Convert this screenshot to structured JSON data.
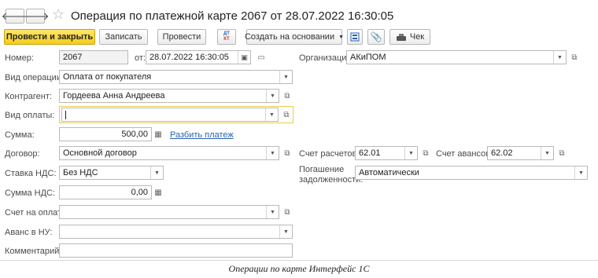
{
  "window": {
    "title": "Операция по платежной карте 2067 от 28.07.2022 16:30:05",
    "back_glyph": "🡐",
    "forward_glyph": "🡒",
    "star_glyph": "☆"
  },
  "toolbar": {
    "post_and_close": "Провести и закрыть",
    "save": "Записать",
    "post": "Провести",
    "dt_kt_top": "ДТ",
    "dt_kt_bottom": "КТ",
    "create_based_on": "Создать на основании",
    "check": "Чек"
  },
  "form": {
    "number_label": "Номер:",
    "number_value": "2067",
    "date_label": "от:",
    "date_value": "28.07.2022 16:30:05",
    "organization_label": "Организация:",
    "organization_value": "АКиПОМ",
    "operation_type_label": "Вид операции:",
    "operation_type_value": "Оплата от покупателя",
    "counterparty_label": "Контрагент:",
    "counterparty_value": "Гордеева Анна Андреева",
    "payment_type_label": "Вид оплаты:",
    "payment_type_value": "",
    "amount_label": "Сумма:",
    "amount_value": "500,00",
    "split_payment_link": "Разбить платеж",
    "contract_label": "Договор:",
    "contract_value": "Основной договор",
    "settlement_account_label": "Счет расчетов:",
    "settlement_account_value": "62.01",
    "advance_account_label": "Счет авансов:",
    "advance_account_value": "62.02",
    "vat_rate_label": "Ставка НДС:",
    "vat_rate_value": "Без НДС",
    "debt_repayment_label_1": "Погашение",
    "debt_repayment_label_2": "задолженности:",
    "debt_repayment_value": "Автоматически",
    "vat_amount_label": "Сумма НДС:",
    "vat_amount_value": "0,00",
    "invoice_label": "Счет на оплату:",
    "invoice_value": "",
    "advance_nu_label": "Аванс в НУ:",
    "advance_nu_value": "",
    "comment_label": "Комментарий:",
    "comment_value": ""
  },
  "caption": "Операции по карте Интерфейс 1С"
}
